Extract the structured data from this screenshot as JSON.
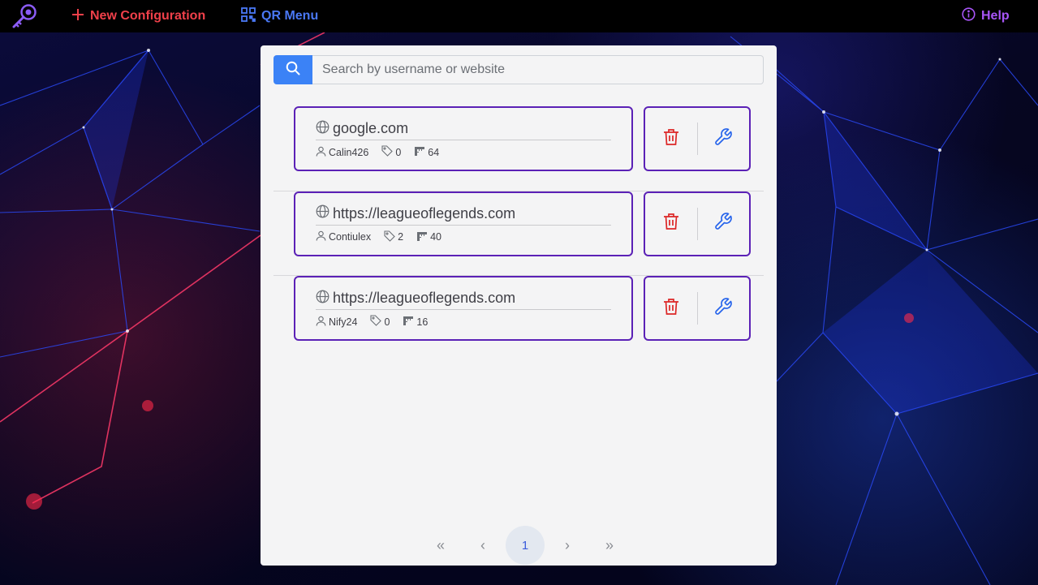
{
  "topbar": {
    "new_config_label": "New Configuration",
    "qr_menu_label": "QR Menu",
    "help_label": "Help"
  },
  "search": {
    "placeholder": "Search by username or website",
    "value": ""
  },
  "entries": [
    {
      "site": "google.com",
      "username": "Calin426",
      "tags": "0",
      "length": "64"
    },
    {
      "site": "https://leagueoflegends.com",
      "username": "Contiulex",
      "tags": "2",
      "length": "40"
    },
    {
      "site": "https://leagueoflegends.com",
      "username": "Nify24",
      "tags": "0",
      "length": "16"
    }
  ],
  "pagination": {
    "first": "«",
    "prev": "‹",
    "current": "1",
    "next": "›",
    "last": "»"
  },
  "icons": {
    "logo": "key-icon",
    "new_config": "plus-icon",
    "qr_menu": "qr-code-icon",
    "help": "info-icon",
    "search": "search-icon",
    "site": "globe-icon",
    "username": "user-icon",
    "tags": "tag-icon",
    "length": "ruler-icon",
    "delete": "trash-icon",
    "edit": "wrench-icon"
  },
  "colors": {
    "new_config": "#f0404a",
    "qr_menu": "#4a78f5",
    "help": "#a855f7",
    "card_border": "#5b21b6",
    "search_button": "#3b82f6",
    "delete_icon": "#dc2626",
    "edit_icon": "#2563eb",
    "panel_bg": "#f4f4f5"
  }
}
